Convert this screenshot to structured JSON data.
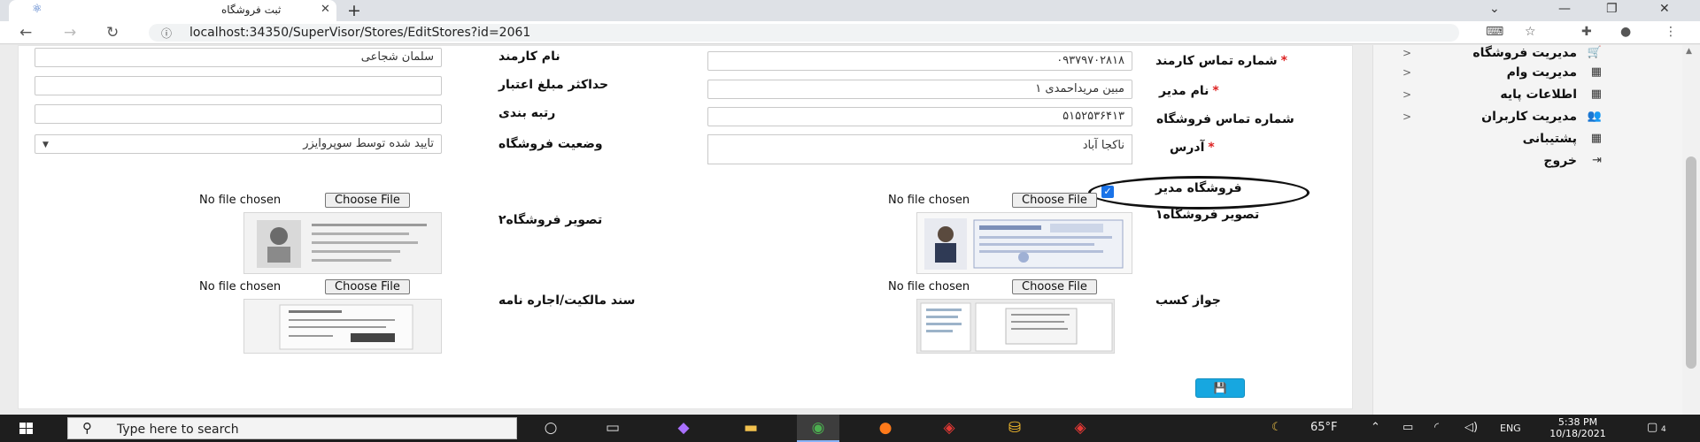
{
  "browser": {
    "tab_title": "ثبت فروشگاه",
    "url": "localhost:34350/SuperVisor/Stores/EditStores?id=2061"
  },
  "form": {
    "right": {
      "phone_label": "شماره تماس کارمند",
      "phone_value": "۰۹۳۷۹۷۰۲۸۱۸",
      "manager_label": "نام مدیر",
      "manager_value": "مبین مریداحمدی ۱",
      "store_phone_label": "شماره تماس فروشگاه",
      "store_phone_value": "۵۱۵۲۵۳۶۴۱۳",
      "address_label": "آدرس",
      "address_value": "ناکجا آباد",
      "store_manager_label": "فروشگاه مدیر",
      "store_manager_checked": true,
      "image1_label": "تصویر فروشگاه۱",
      "license_label": "جواز کسب"
    },
    "left": {
      "employee_label": "نام کارمند",
      "employee_value": "سلمان شجاعی",
      "credit_label": "حداکثر مبلغ اعتبار",
      "credit_value": "",
      "rank_label": "رتبه بندی",
      "rank_value": "",
      "status_label": "وضعیت فروشگاه",
      "status_value": "تایید شده توسط سوپروایزر",
      "image2_label": "تصویر فروشگاه۲",
      "deed_label": "سند مالکیت/اجاره نامه"
    },
    "file_input": {
      "button": "Choose File",
      "status": "No file chosen"
    }
  },
  "sidebar": {
    "items": [
      {
        "label": "مدیریت فروشگاه",
        "icon": "cart-icon",
        "chevron": "<"
      },
      {
        "label": "مدیریت وام",
        "icon": "grid-icon",
        "chevron": "<"
      },
      {
        "label": "اطلاعات پایه",
        "icon": "grid-icon",
        "chevron": "<"
      },
      {
        "label": "مدیریت کاربران",
        "icon": "users-icon",
        "chevron": "<"
      },
      {
        "label": "پشتیبانی",
        "icon": "grid-icon"
      },
      {
        "label": "خروج",
        "icon": "exit-icon"
      }
    ]
  },
  "taskbar": {
    "search_placeholder": "Type here to search",
    "weather": "65°F",
    "lang": "ENG",
    "time": "5:38 PM",
    "date": "10/18/2021",
    "notifications": "4"
  }
}
